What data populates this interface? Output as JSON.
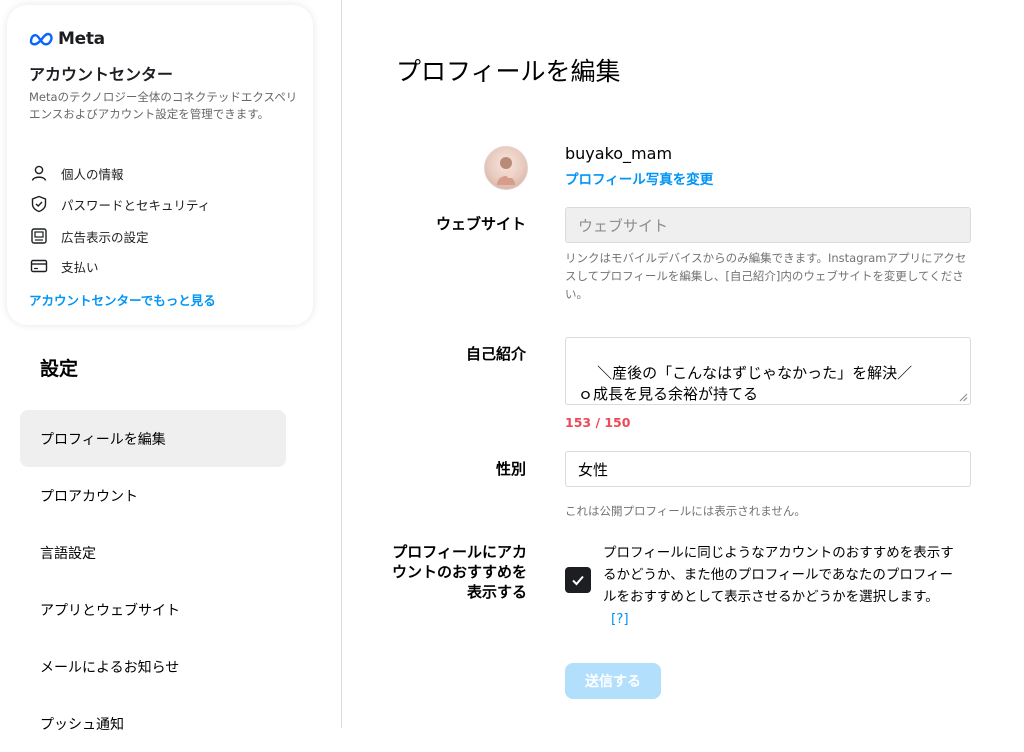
{
  "accounts_center": {
    "brand": "Meta",
    "title": "アカウントセンター",
    "description": "Metaのテクノロジー全体のコネクテッドエクスペリエンスおよびアカウント設定を管理できます。",
    "items": [
      {
        "label": "個人の情報",
        "icon": "person-icon"
      },
      {
        "label": "パスワードとセキュリティ",
        "icon": "shield-check-icon"
      },
      {
        "label": "広告表示の設定",
        "icon": "ad-preferences-icon"
      },
      {
        "label": "支払い",
        "icon": "credit-card-icon"
      }
    ],
    "more_link": "アカウントセンターでもっと見る"
  },
  "settings": {
    "heading": "設定",
    "nav": [
      {
        "label": "プロフィールを編集",
        "active": true
      },
      {
        "label": "プロアカウント",
        "active": false
      },
      {
        "label": "言語設定",
        "active": false
      },
      {
        "label": "アプリとウェブサイト",
        "active": false
      },
      {
        "label": "メールによるお知らせ",
        "active": false
      },
      {
        "label": "プッシュ通知",
        "active": false
      }
    ]
  },
  "profile": {
    "page_title": "プロフィールを編集",
    "username": "buyako_mam",
    "change_photo": "プロフィール写真を変更",
    "website": {
      "label": "ウェブサイト",
      "placeholder": "ウェブサイト",
      "help": "リンクはモバイルデバイスからのみ編集できます。Instagramアプリにアクセスしてプロフィールを編集し、[自己紹介]内のウェブサイトを変更してください。"
    },
    "bio": {
      "label": "自己紹介",
      "value": "＼産後の「こんなはずじゃなかった」を解決／\nｏ成長を見る余裕が持てる\nｏパートナーにも優しくなれる",
      "counter": "153 / 150"
    },
    "gender": {
      "label": "性別",
      "value": "女性",
      "help": "これは公開プロフィールには表示されません。"
    },
    "suggestions": {
      "label": "プロフィールにアカウントのおすすめを表示する",
      "checked": true,
      "text": "プロフィールに同じようなアカウントのおすすめを表示するかどうか、また他のプロフィールであなたのプロフィールをおすすめとして表示させるかどうかを選択します。",
      "help_link": "[?]"
    },
    "submit": "送信する"
  },
  "colors": {
    "accent": "#0095f6",
    "error": "#ed4956",
    "submit_disabled": "#b2dffc",
    "active_nav": "#efefef"
  }
}
